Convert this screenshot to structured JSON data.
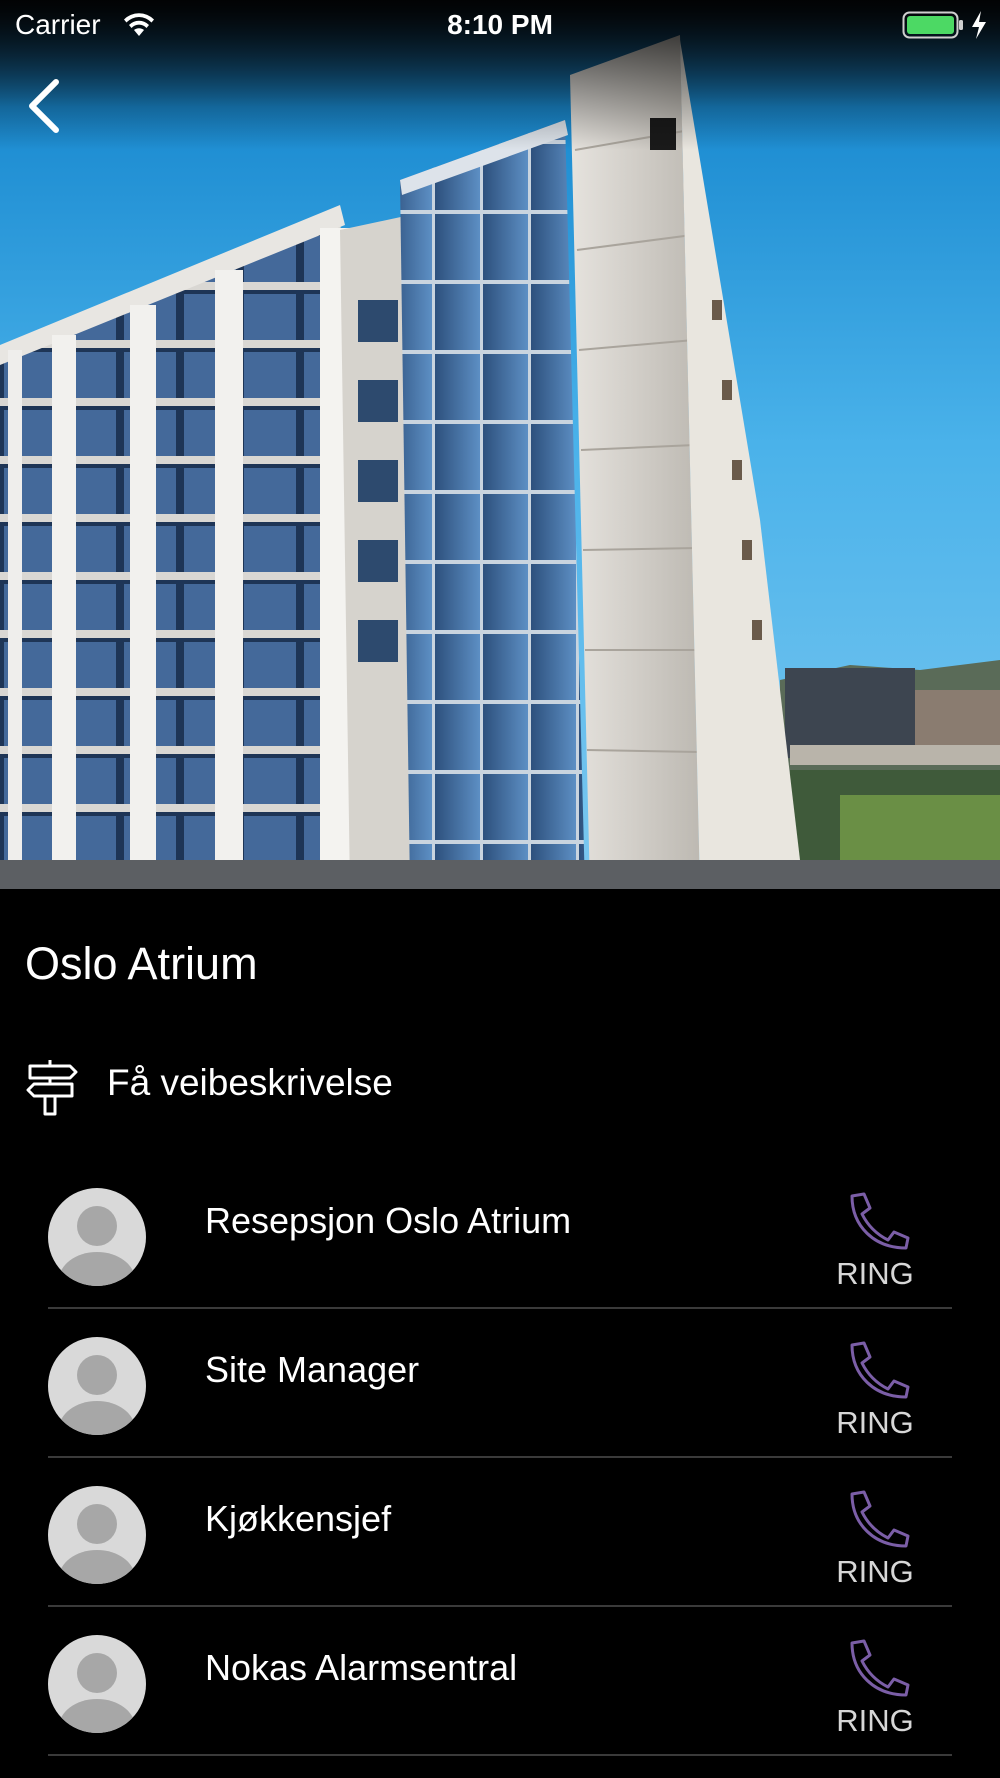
{
  "status_bar": {
    "carrier": "Carrier",
    "time": "8:10 PM",
    "wifi_icon": "wifi-icon",
    "battery_icon": "battery-icon",
    "charging_icon": "charging-bolt-icon",
    "battery_color": "#4cd964"
  },
  "hero": {
    "image": "building-photo"
  },
  "navigation": {
    "back_icon": "chevron-left-icon"
  },
  "place": {
    "title": "Oslo Atrium"
  },
  "directions": {
    "icon": "signpost-icon",
    "label": "Få veibeskrivelse"
  },
  "contacts": [
    {
      "name": "Resepsjon Oslo Atrium",
      "action_label": "RING"
    },
    {
      "name": "Site Manager",
      "action_label": "RING"
    },
    {
      "name": "Kjøkkensjef",
      "action_label": "RING"
    },
    {
      "name": "Nokas Alarmsentral",
      "action_label": "RING"
    }
  ],
  "colors": {
    "background": "#000000",
    "accent_phone": "#7b5ea7",
    "divider": "#3a3a3a",
    "avatar_bg": "#d9d9d9"
  }
}
